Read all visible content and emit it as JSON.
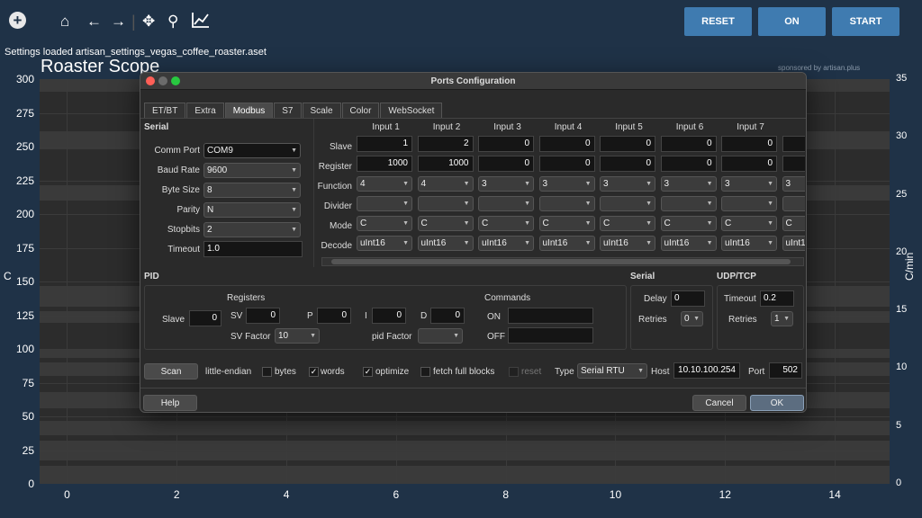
{
  "toolbar": {
    "icons": [
      "plus-icon",
      "home-icon",
      "back-arrow-icon",
      "forward-arrow-icon",
      "move-icon",
      "zoom-icon",
      "chart-icon"
    ],
    "reset_label": "RESET",
    "on_label": "ON",
    "start_label": "START"
  },
  "status": "Settings loaded artisan_settings_vegas_coffee_roaster.aset",
  "scope_title": "Roaster Scope",
  "sponsor": "sponsored by artisan.plus",
  "chart_data": {
    "type": "line",
    "title": "Roaster Scope",
    "ylabel": "C",
    "y2label": "C/min",
    "xlim": [
      -0.5,
      15
    ],
    "ylim": [
      0,
      300
    ],
    "y2lim": [
      0,
      35
    ],
    "x_ticks": [
      "0",
      "2",
      "4",
      "6",
      "8",
      "10",
      "12",
      "14"
    ],
    "y_ticks": [
      "0",
      "25",
      "50",
      "75",
      "100",
      "125",
      "150",
      "175",
      "200",
      "225",
      "250",
      "275",
      "300"
    ],
    "y2_ticks": [
      "0",
      "5",
      "10",
      "15",
      "20",
      "25",
      "30",
      "35"
    ],
    "series": []
  },
  "dialog": {
    "title": "Ports Configuration",
    "tabs": [
      "ET/BT",
      "Extra",
      "Modbus",
      "S7",
      "Scale",
      "Color",
      "WebSocket"
    ],
    "serial": {
      "title": "Serial",
      "comm_port_label": "Comm Port",
      "comm_port": "COM9",
      "baud_label": "Baud Rate",
      "baud": "9600",
      "bytesize_label": "Byte Size",
      "bytesize": "8",
      "parity_label": "Parity",
      "parity": "N",
      "stopbits_label": "Stopbits",
      "stopbits": "2",
      "timeout_label": "Timeout",
      "timeout": "1.0"
    },
    "inputs": {
      "row_labels": {
        "slave": "Slave",
        "register": "Register",
        "function": "Function",
        "divider": "Divider",
        "mode": "Mode",
        "decode": "Decode"
      },
      "columns": [
        {
          "name": "Input 1",
          "slave": "1",
          "register": "1000",
          "function": "4",
          "mode": "C",
          "decode": "uInt16"
        },
        {
          "name": "Input 2",
          "slave": "2",
          "register": "1000",
          "function": "4",
          "mode": "C",
          "decode": "uInt16"
        },
        {
          "name": "Input 3",
          "slave": "0",
          "register": "0",
          "function": "3",
          "mode": "C",
          "decode": "uInt16"
        },
        {
          "name": "Input 4",
          "slave": "0",
          "register": "0",
          "function": "3",
          "mode": "C",
          "decode": "uInt16"
        },
        {
          "name": "Input 5",
          "slave": "0",
          "register": "0",
          "function": "3",
          "mode": "C",
          "decode": "uInt16"
        },
        {
          "name": "Input 6",
          "slave": "0",
          "register": "0",
          "function": "3",
          "mode": "C",
          "decode": "uInt16"
        },
        {
          "name": "Input 7",
          "slave": "0",
          "register": "0",
          "function": "3",
          "mode": "C",
          "decode": "uInt16"
        },
        {
          "name": "In",
          "slave": "",
          "register": "",
          "function": "3",
          "mode": "C",
          "decode": "uInt1"
        }
      ]
    },
    "pid": {
      "title": "PID",
      "registers_label": "Registers",
      "slave_label": "Slave",
      "slave": "0",
      "sv_label": "SV",
      "sv": "0",
      "p_label": "P",
      "p": "0",
      "i_label": "I",
      "i": "0",
      "d_label": "D",
      "d": "0",
      "svfactor_label": "SV Factor",
      "svfactor": "10",
      "pidfactor_label": "pid Factor",
      "pidfactor": "",
      "commands_label": "Commands",
      "on_label": "ON",
      "on": "",
      "off_label": "OFF",
      "off": ""
    },
    "serial2": {
      "title": "Serial",
      "delay_label": "Delay",
      "delay": "0",
      "retries_label": "Retries",
      "retries": "0"
    },
    "udp": {
      "title": "UDP/TCP",
      "timeout_label": "Timeout",
      "timeout": "0.2",
      "retries_label": "Retries",
      "retries": "1"
    },
    "bottom": {
      "scan_label": "Scan",
      "little_endian_label": "little-endian",
      "bytes_label": "bytes",
      "words_label": "words",
      "optimize_label": "optimize",
      "fetch_label": "fetch full blocks",
      "reset_label": "reset",
      "type_label": "Type",
      "type": "Serial RTU",
      "host_label": "Host",
      "host": "10.10.100.254",
      "port_label": "Port",
      "port": "502"
    },
    "help_label": "Help",
    "cancel_label": "Cancel",
    "ok_label": "OK"
  }
}
